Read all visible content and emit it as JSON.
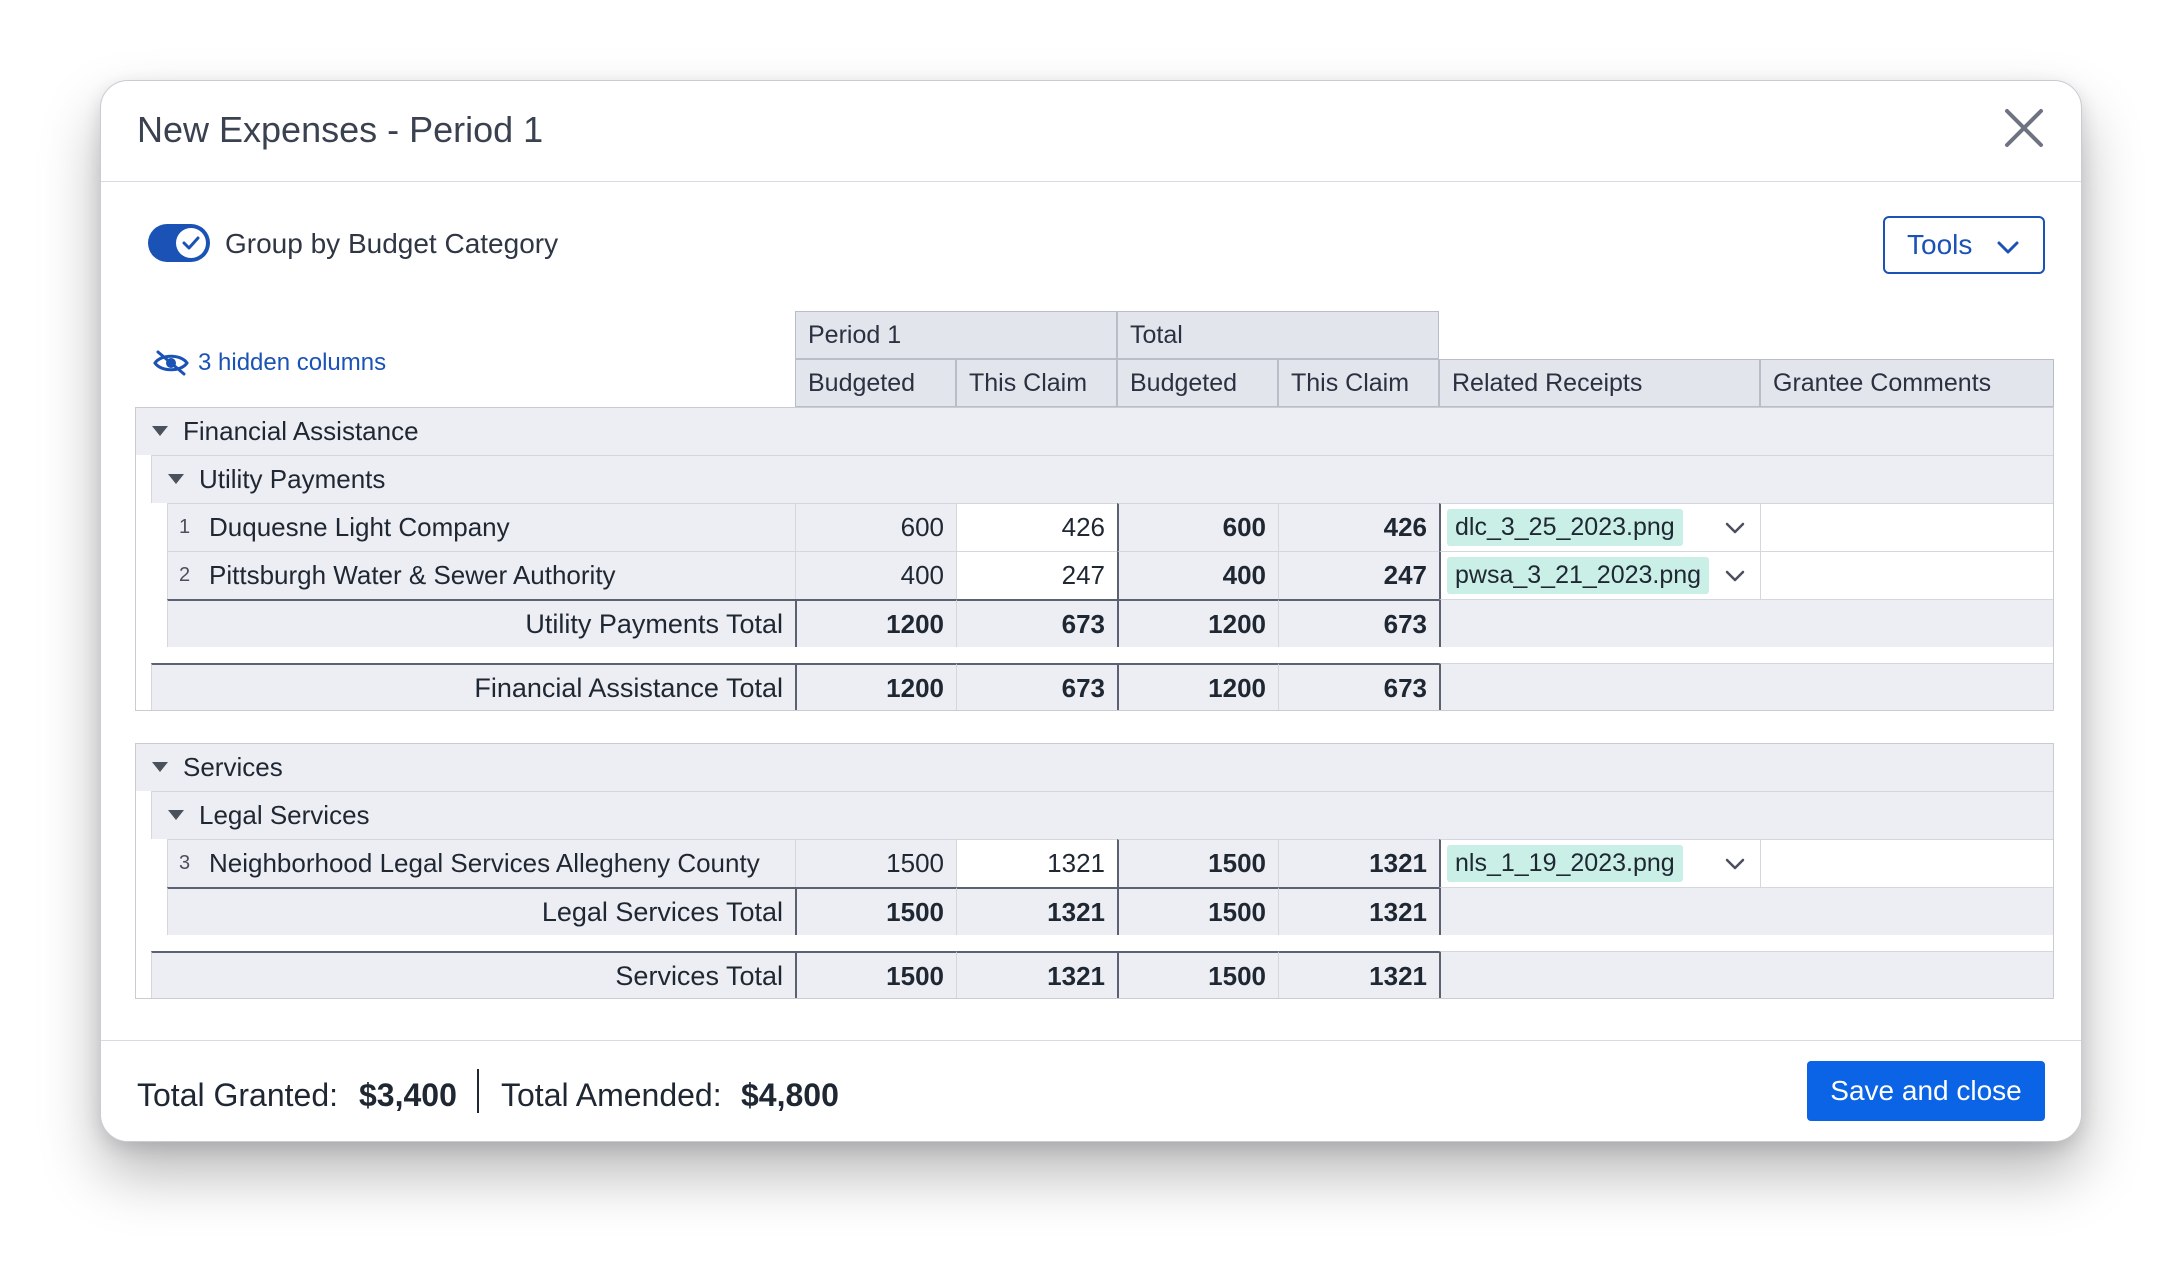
{
  "modal": {
    "title": "New Expenses - Period 1",
    "close_icon": "close-icon"
  },
  "toolbar": {
    "group_toggle_label": "Group by Budget Category",
    "group_toggle_on": true,
    "tools_label": "Tools",
    "hidden_columns_label": "3 hidden columns"
  },
  "table": {
    "group_headers": [
      "Period 1",
      "Total"
    ],
    "columns": [
      "Budgeted",
      "This Claim",
      "Budgeted",
      "This Claim",
      "Related Receipts",
      "Grantee Comments"
    ],
    "categories": [
      {
        "name": "Financial Assistance",
        "subcategories": [
          {
            "name": "Utility Payments",
            "rows": [
              {
                "index": "1",
                "name": "Duquesne Light Company",
                "p1_budgeted": "600",
                "p1_claim": "426",
                "total_budgeted": "600",
                "total_claim": "426",
                "receipt": "dlc_3_25_2023.png",
                "comment": ""
              },
              {
                "index": "2",
                "name": "Pittsburgh Water & Sewer Authority",
                "p1_budgeted": "400",
                "p1_claim": "247",
                "total_budgeted": "400",
                "total_claim": "247",
                "receipt": "pwsa_3_21_2023.png",
                "comment": ""
              }
            ],
            "total_label": "Utility Payments Total",
            "totals": [
              "1200",
              "673",
              "1200",
              "673"
            ]
          }
        ],
        "total_label": "Financial Assistance Total",
        "totals": [
          "1200",
          "673",
          "1200",
          "673"
        ]
      },
      {
        "name": "Services",
        "subcategories": [
          {
            "name": "Legal Services",
            "rows": [
              {
                "index": "3",
                "name": "Neighborhood Legal Services Allegheny County",
                "p1_budgeted": "1500",
                "p1_claim": "1321",
                "total_budgeted": "1500",
                "total_claim": "1321",
                "receipt": "nls_1_19_2023.png",
                "comment": ""
              }
            ],
            "total_label": "Legal Services Total",
            "totals": [
              "1500",
              "1321",
              "1500",
              "1321"
            ]
          }
        ],
        "total_label": "Services Total",
        "totals": [
          "1500",
          "1321",
          "1500",
          "1321"
        ]
      }
    ]
  },
  "footer": {
    "granted_label": "Total Granted:",
    "granted_value": "$3,400",
    "amended_label": "Total Amended:",
    "amended_value": "$4,800",
    "save_label": "Save and close"
  },
  "colors": {
    "accent": "#1a52b5",
    "save_button": "#0b63e5",
    "receipt_chip": "#c9efe6",
    "header_bg": "#e3e5ec"
  }
}
